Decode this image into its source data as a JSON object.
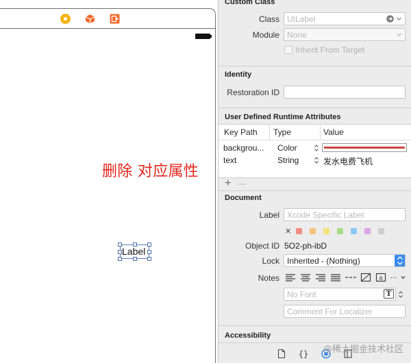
{
  "annotation": "删除 对应属性",
  "canvas": {
    "label_text": "Label",
    "dock_icons": [
      "first-responder-icon",
      "cube-icon",
      "exit-icon"
    ],
    "colors": {
      "first_responder": "#f5b316",
      "cube": "#f06a2c",
      "exit": "#f06a2c",
      "annotation": "#e0261c"
    }
  },
  "custom_class": {
    "title": "Custom Class",
    "class_label": "Class",
    "class_value": "UILabel",
    "module_label": "Module",
    "module_value": "None",
    "inherit_label": "Inherit From Target"
  },
  "identity": {
    "title": "Identity",
    "restoration_label": "Restoration ID",
    "restoration_value": ""
  },
  "runtime_attributes": {
    "title": "User Defined Runtime Attributes",
    "columns": [
      "Key Path",
      "Type",
      "Value"
    ],
    "rows": [
      {
        "key_path": "backgrou...",
        "type": "Color",
        "value": "",
        "color": "#c9473e"
      },
      {
        "key_path": "text",
        "type": "String",
        "value": "发水电费飞机"
      }
    ],
    "add_symbol": "+",
    "remove_symbol": "—"
  },
  "document": {
    "title": "Document",
    "label_label": "Label",
    "label_placeholder": "Xcode Specific Label",
    "clear_symbol": "✕",
    "label_colors": [
      "#f28b82",
      "#f7c27a",
      "#f4e37a",
      "#a6dc86",
      "#8cc8f5",
      "#d9a6e8",
      "#cfcfcf"
    ],
    "object_id_label": "Object ID",
    "object_id_value": "5O2-ph-ibD",
    "lock_label": "Lock",
    "lock_value": "Inherited - (Nothing)",
    "notes_label": "Notes",
    "notes_more": "...",
    "font_placeholder": "No Font",
    "font_icon_letter": "T",
    "localizer_placeholder": "Comment For Localizer"
  },
  "accessibility": {
    "title": "Accessibility"
  },
  "bottom_tabs": [
    "file-icon",
    "braces-icon",
    "identity-icon",
    "quick-help-icon"
  ],
  "watermark": "@稀土掘金技术社区"
}
